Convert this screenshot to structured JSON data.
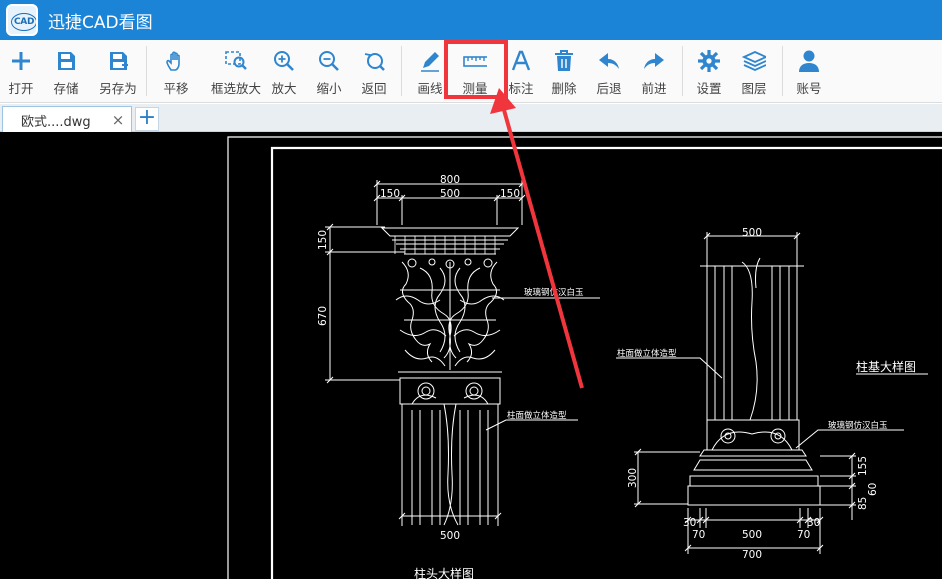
{
  "app": {
    "title": "迅捷CAD看图",
    "logo_text": "CAD"
  },
  "toolbar": {
    "open": "打开",
    "save": "存储",
    "save_as": "另存为",
    "pan": "平移",
    "zoom_window": "框选放大",
    "zoom_in": "放大",
    "zoom_out": "缩小",
    "back": "返回",
    "draw_line": "画线",
    "measure": "测量",
    "annotate": "标注",
    "delete": "删除",
    "undo": "后退",
    "redo": "前进",
    "settings": "设置",
    "layers": "图层",
    "account": "账号"
  },
  "tabs": {
    "active_file": "欧式....dwg",
    "close_glyph": "×",
    "add_glyph": "+"
  },
  "drawing": {
    "left": {
      "dim_total": "800",
      "dim_a": "150",
      "dim_b": "500",
      "dim_c": "150",
      "dim_v1": "150",
      "dim_v2": "670",
      "dim_bottom": "500",
      "note_1": "玻璃钢仿汉白玉",
      "note_2": "柱面做立体造型",
      "title": "柱头大样图"
    },
    "right": {
      "dim_top": "500",
      "dim_v_left": "300",
      "dim_r1": "155",
      "dim_r2": "60",
      "dim_r3": "85",
      "dim_b1": "30",
      "dim_b2": "70",
      "dim_b3": "500",
      "dim_b4": "70",
      "dim_b5": "30",
      "dim_total": "700",
      "note_1": "柱面做立体造型",
      "note_2": "玻璃钢仿汉白玉",
      "title": "柱基大样图"
    }
  },
  "colors": {
    "titlebar": "#1b84d6",
    "icon": "#2f86cf",
    "highlight": "#f0353d",
    "canvas": "#000000",
    "lines": "#ffffff"
  }
}
